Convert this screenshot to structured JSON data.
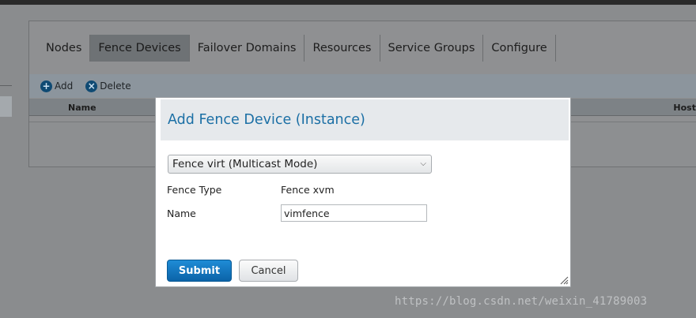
{
  "nav": {
    "tabs": [
      {
        "label": "Nodes"
      },
      {
        "label": "Fence Devices"
      },
      {
        "label": "Failover Domains"
      },
      {
        "label": "Resources"
      },
      {
        "label": "Service Groups"
      },
      {
        "label": "Configure"
      }
    ],
    "active_tab": "Fence Devices"
  },
  "toolbar": {
    "add_label": "Add",
    "add_icon": "plus-circle-icon",
    "delete_label": "Delete",
    "delete_icon": "x-circle-icon"
  },
  "table": {
    "columns": [
      "Name",
      "Host"
    ]
  },
  "dialog": {
    "title": "Add Fence Device (Instance)",
    "device_select": "Fence virt (Multicast Mode)",
    "fence_type_label": "Fence Type",
    "fence_type_value": "Fence xvm",
    "name_label": "Name",
    "name_value": "vimfence",
    "submit_label": "Submit",
    "cancel_label": "Cancel"
  },
  "watermark": "https://blog.csdn.net/weixin_41789003",
  "colors": {
    "accent": "#1b6fa5",
    "submit": "#1479c2",
    "overlay": "#8a8c8e"
  }
}
